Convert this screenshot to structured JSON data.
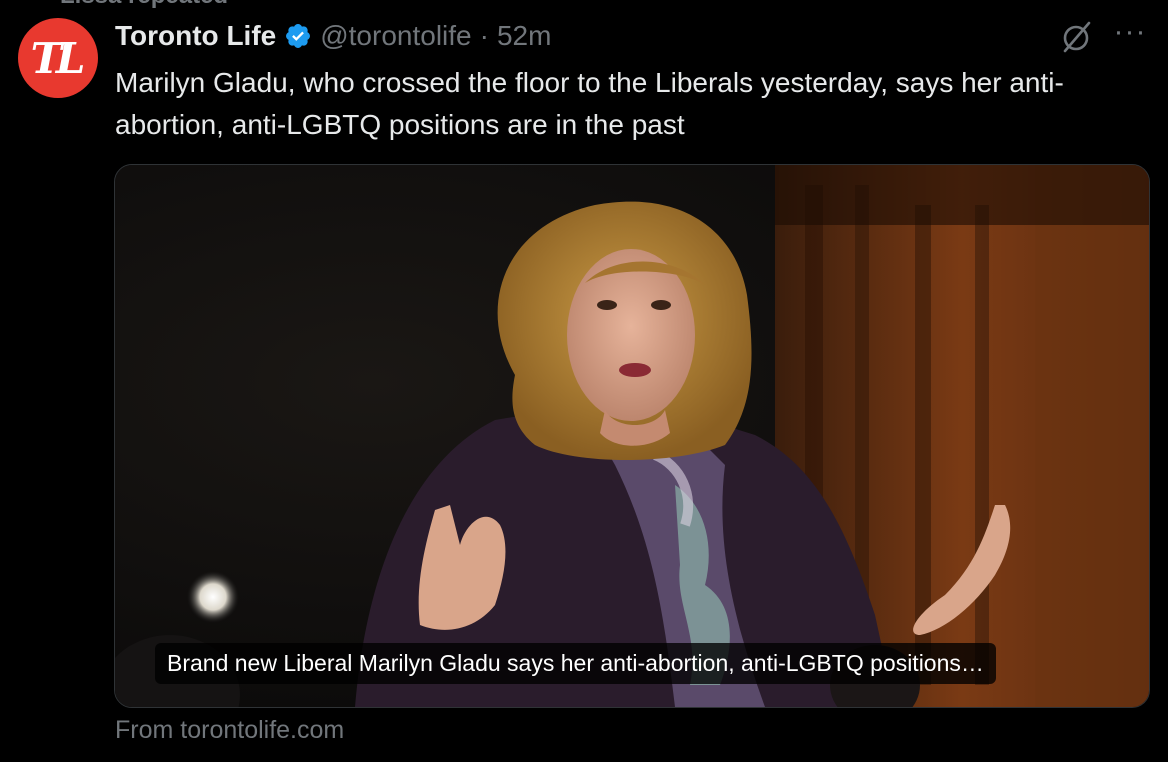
{
  "repost": {
    "label": "Lissa repeated"
  },
  "author": {
    "avatar_text": "TL",
    "display_name": "Toronto Life",
    "handle": "@torontolife",
    "separator": "·",
    "time": "52m",
    "verified_color": "#1d9bf0"
  },
  "tweet": {
    "text": "Marilyn Gladu, who crossed the floor to the Liberals yesterday, says her anti-abortion, anti-LGBTQ positions are in the past"
  },
  "card": {
    "title": "Brand new Liberal Marilyn Gladu says her anti-abortion, anti-LGBTQ positions…",
    "source": "From torontolife.com"
  },
  "icons": {
    "grok": "grok-icon",
    "more": "more-icon",
    "verified": "verified-badge-icon"
  },
  "colors": {
    "background": "#000000",
    "text": "#e7e9ea",
    "secondary": "#71767b",
    "brand_red": "#e8392f"
  }
}
